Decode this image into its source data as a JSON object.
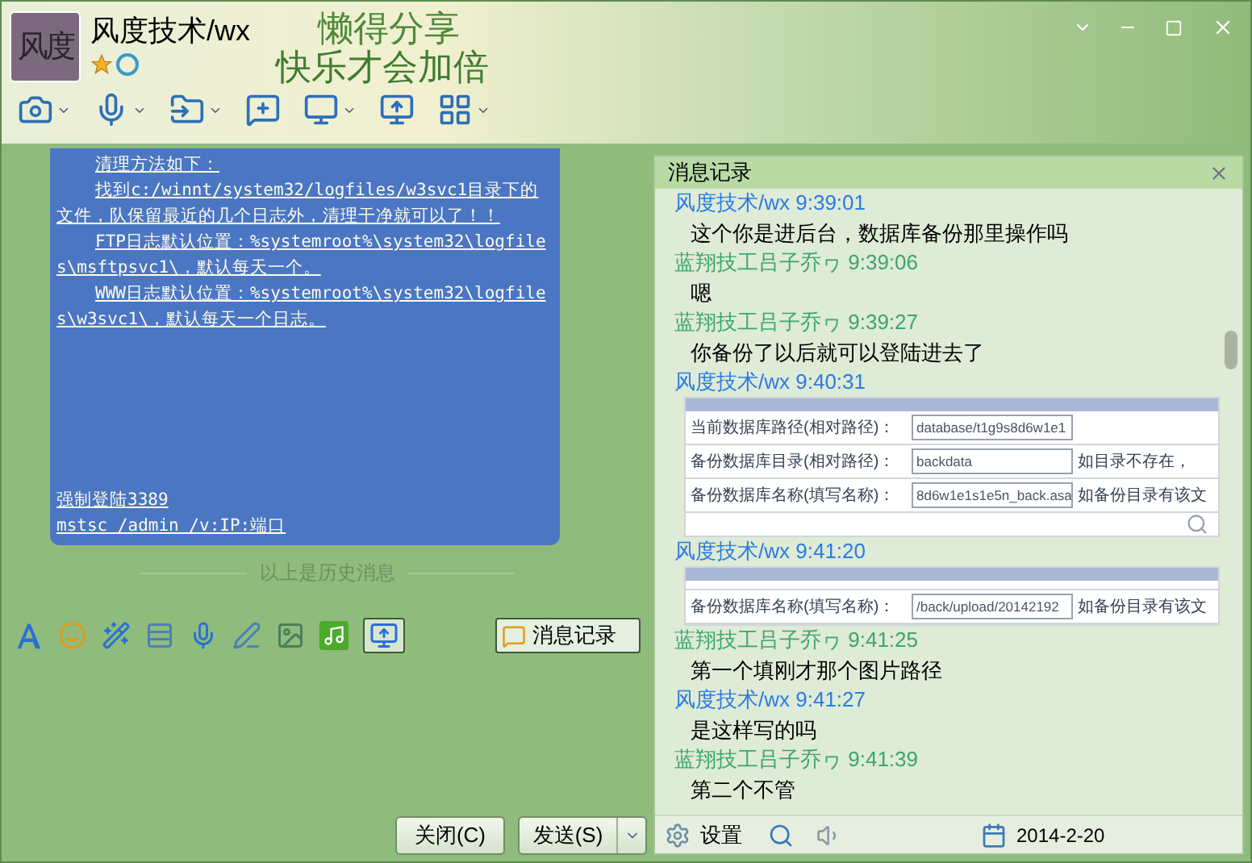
{
  "window": {
    "title": "风度技术/wx",
    "avatar_text": "风度",
    "slogan": [
      "懒得分享",
      "快乐才会加倍"
    ]
  },
  "history_bubble": {
    "paragraphs": [
      "清理方法如下：",
      "找到c:/winnt/system32/logfiles/w3svc1目录下的文件，队保留最近的几个日志外，清理干净就可以了！！",
      "FTP日志默认位置：%systemroot%\\system32\\logfiles\\msftpsvc1\\，默认每天一个。",
      "WWW日志默认位置：%systemroot%\\system32\\logfiles\\w3svc1\\，默认每天一个日志。"
    ],
    "footer_lines": [
      "强制登陆3389",
      "mstsc /admin /v:IP:端口"
    ]
  },
  "history_divider": "以上是历史消息",
  "history_toggle": {
    "label": "消息记录",
    "selected": true
  },
  "buttons": [
    {
      "label": "关闭(C)",
      "kind": "plain"
    },
    {
      "label": "发送(S)",
      "kind": "split"
    }
  ],
  "record_panel": {
    "title": "消息记录",
    "messages": [
      {
        "sender": "风度技术/wx",
        "time": "9:39:01",
        "color": "#2a7be4",
        "kind": "text",
        "text": "这个你是进后台，数据库备份那里操作吗"
      },
      {
        "sender": "蓝翔技工吕子乔ヮ",
        "time": "9:39:06",
        "color": "#3ca66c",
        "kind": "text",
        "text": "嗯"
      },
      {
        "sender": "蓝翔技工吕子乔ヮ",
        "time": "9:39:27",
        "color": "#3ca66c",
        "kind": "text",
        "text": "你备份了以后就可以登陆进去了"
      },
      {
        "sender": "风度技术/wx",
        "time": "9:40:31",
        "color": "#2a7be4",
        "kind": "image",
        "rows": [
          {
            "label": "当前数据库路径(相对路径)：",
            "value": "database/t1g9s8d6w1e1",
            "note": ""
          },
          {
            "label": "备份数据库目录(相对路径)：",
            "value": "backdata",
            "note": "如目录不存在，"
          },
          {
            "label": "备份数据库名称(填写名称)：",
            "value": "8d6w1e1s1e5n_back.asa",
            "note": "如备份目录有该文"
          }
        ]
      },
      {
        "sender": "风度技术/wx",
        "time": "9:41:20",
        "color": "#2a7be4",
        "kind": "image",
        "rows": [
          {
            "label": "备份数据库名称(填写名称)：",
            "value": "/back/upload/20142192",
            "note": "如备份目录有该文"
          }
        ]
      },
      {
        "sender": "蓝翔技工吕子乔ヮ",
        "time": "9:41:25",
        "color": "#3ca66c",
        "kind": "text",
        "text": "第一个填刚才那个图片路径"
      },
      {
        "sender": "风度技术/wx",
        "time": "9:41:27",
        "color": "#2a7be4",
        "kind": "text",
        "text": "是这样写的吗"
      },
      {
        "sender": "蓝翔技工吕子乔ヮ",
        "time": "9:41:39",
        "color": "#3ca66c",
        "kind": "text",
        "text": "第二个不管"
      }
    ],
    "settings_label": "设置",
    "date": "2014-2-20"
  }
}
